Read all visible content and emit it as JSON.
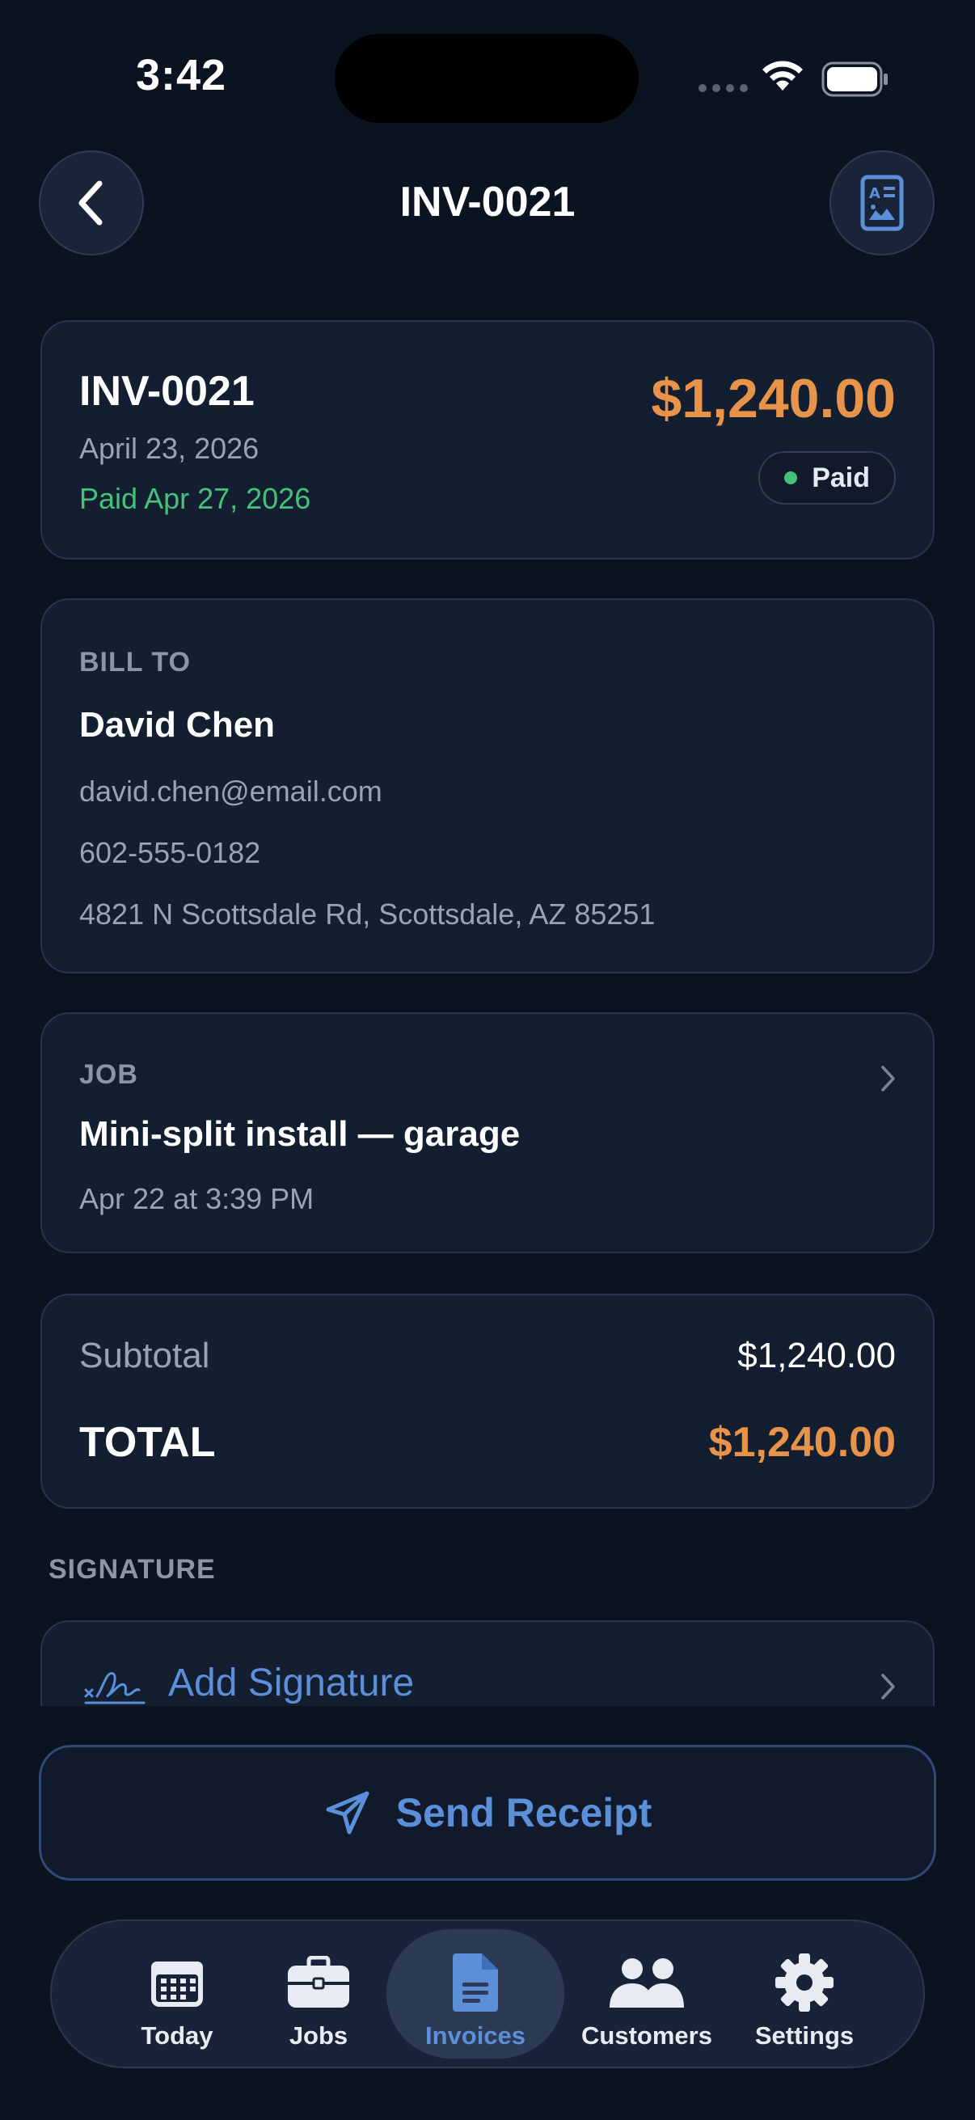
{
  "status_bar": {
    "time": "3:42"
  },
  "header": {
    "title": "INV-0021"
  },
  "invoice": {
    "number": "INV-0021",
    "date": "April 23, 2026",
    "paid_date": "Paid Apr 27, 2026",
    "amount": "$1,240.00",
    "status": "Paid"
  },
  "bill_to": {
    "label": "BILL TO",
    "name": "David Chen",
    "email": "david.chen@email.com",
    "phone": "602-555-0182",
    "address": "4821 N Scottsdale Rd, Scottsdale, AZ 85251"
  },
  "job": {
    "label": "JOB",
    "title": "Mini-split install — garage",
    "time": "Apr 22 at 3:39 PM"
  },
  "totals": {
    "subtotal_label": "Subtotal",
    "subtotal_value": "$1,240.00",
    "total_label": "TOTAL",
    "total_value": "$1,240.00"
  },
  "signature": {
    "heading": "SIGNATURE",
    "add_label": "Add Signature"
  },
  "send_receipt": {
    "label": "Send Receipt"
  },
  "tabs": [
    {
      "label": "Today",
      "icon": "calendar-icon"
    },
    {
      "label": "Jobs",
      "icon": "briefcase-icon"
    },
    {
      "label": "Invoices",
      "icon": "document-icon",
      "active": true
    },
    {
      "label": "Customers",
      "icon": "people-icon"
    },
    {
      "label": "Settings",
      "icon": "gear-icon"
    }
  ],
  "colors": {
    "background": "#0b1220",
    "card": "#131e30",
    "accent_amount": "#e8934a",
    "paid_green": "#44c27a",
    "link_blue": "#5b8fd8"
  }
}
